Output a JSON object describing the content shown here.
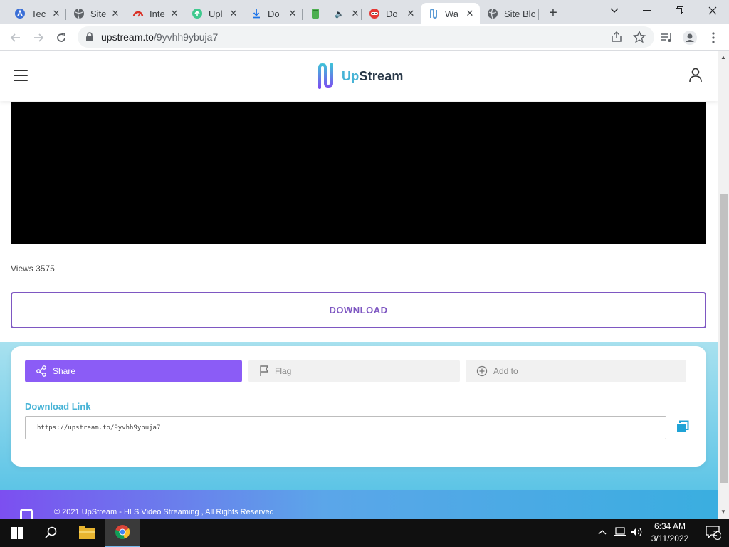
{
  "browser": {
    "tabs": [
      {
        "title": "Tec",
        "favicon": "circle-a-icon"
      },
      {
        "title": "Site",
        "favicon": "globe-icon"
      },
      {
        "title": "Inte",
        "favicon": "gauge-icon"
      },
      {
        "title": "Upl",
        "favicon": "upload-icon"
      },
      {
        "title": "Do",
        "favicon": "download-icon"
      },
      {
        "title": "",
        "favicon": "book-icon"
      },
      {
        "title": "Do",
        "favicon": "ninja-icon"
      },
      {
        "title": "Wa",
        "favicon": "upstream-icon"
      },
      {
        "title": "Site Blo",
        "favicon": "globe-icon"
      }
    ],
    "active_tab_index": 7,
    "url_host": "upstream.to",
    "url_path": "/9yvhh9ybuja7"
  },
  "site": {
    "logo_prefix": "Up",
    "logo_suffix": "Stream",
    "views_text": "Views 3575",
    "download_button": "DOWNLOAD",
    "actions": {
      "share": "Share",
      "flag": "Flag",
      "add_to": "Add to"
    },
    "download_link_label": "Download Link",
    "download_link_value": "https://upstream.to/9yvhh9ybuja7",
    "footer_text": "© 2021 UpStream - HLS Video Streaming , All Rights Reserved"
  },
  "taskbar": {
    "time": "6:34 AM",
    "date": "3/11/2022",
    "notifications": "2"
  },
  "colors": {
    "accent_purple": "#7e57c2",
    "share_button": "#8b5cf6",
    "link_blue": "#46b3d6"
  }
}
